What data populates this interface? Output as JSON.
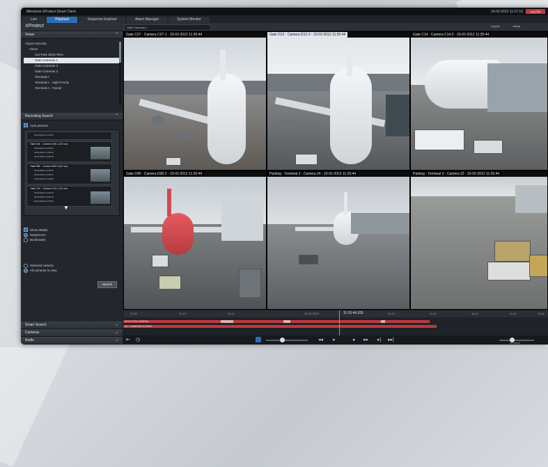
{
  "app": {
    "title": "Milestone XProtect Smart Client",
    "datetime": "23-02-2012 11:27:15",
    "user_badge": "Log Out",
    "brand": "XProtect"
  },
  "tabs": [
    {
      "label": "Live"
    },
    {
      "label": "Playback"
    },
    {
      "label": "Sequence Explorer"
    },
    {
      "label": "Alarm Manager"
    },
    {
      "label": "System Monitor"
    }
  ],
  "active_tab": "Playback",
  "toolbar": {
    "view_select": "Gate Cameras 1",
    "layout_label": "Layout",
    "setup_label": "Setup"
  },
  "views_panel": {
    "title": "Views",
    "tree": [
      {
        "label": "Airport Security",
        "selected": false
      },
      {
        "label": "Views",
        "selected": false
      },
      {
        "label": "Car Park Short Term",
        "selected": false
      },
      {
        "label": "Gate Cameras 1",
        "selected": true
      },
      {
        "label": "Gate Cameras 2",
        "selected": false
      },
      {
        "label": "Gate Cameras 3",
        "selected": false
      },
      {
        "label": "Terminal A",
        "selected": false
      },
      {
        "label": "Terminal A - High Priority",
        "selected": false
      },
      {
        "label": "Terminal A - Transit",
        "selected": false
      }
    ]
  },
  "recording_search": {
    "title": "Recording Search",
    "auto_preview": "Auto preview",
    "results": [
      {
        "title": "",
        "lines": [
          "23-02-2012 11:24:30",
          "",
          ""
        ]
      },
      {
        "title": "Gate D40 - Camera D40-2 (20 sec)",
        "lines": [
          "22-02-2012 11:25:01",
          "22-02-2012 11:25:16",
          "23-02-2012 11:25:35"
        ]
      },
      {
        "title": "Gate D60 - Camera D60-3 (62 sec)",
        "lines": [
          "22-02-2012 11:26:25",
          "23-02-2012 11:26:37",
          "23-02-2012 11:26:43"
        ]
      },
      {
        "title": "Gate C34 - Camera C34-2 (24 sec)",
        "lines": [
          "23-02-2012 11:25:18",
          "23-02-2012 11:25:42",
          "23-02-2012 11:26:30"
        ]
      }
    ],
    "show_details": "Show details",
    "radio_sequences": "Sequences",
    "radio_bookmarks": "Bookmarks",
    "selected_camera": "Selected camera",
    "all_cameras": "All cameras in view",
    "search_button": "Search"
  },
  "bottom_panels": [
    {
      "title": "Smart Search"
    },
    {
      "title": "Cameras"
    },
    {
      "title": "Audio"
    }
  ],
  "cameras": [
    {
      "caption": "Gate C27 - Camera C27-1 - 23-02-2012 11:25:44",
      "selected": false
    },
    {
      "caption": "Gate D12 - Camera D12-3 - 23-02-2012 11:25:44",
      "selected": true
    },
    {
      "caption": "Gate C14 - Camera C14-2 - 23-02-2012 11:25:44",
      "selected": false
    },
    {
      "caption": "Gate D30 - Camera D30-2 - 23-02-2012 11:25:44",
      "selected": false
    },
    {
      "caption": "Parking - Terminal 3 - Camera 24 - 23-02-2012 11:25:44",
      "selected": false
    },
    {
      "caption": "Parking - Terminal 3 - Camera 22 - 23-02-2012 11:25:44",
      "selected": false
    }
  ],
  "timeline": {
    "ticks": [
      "11:09",
      "11:10",
      "11:11",
      "23-02-2012",
      "11:12",
      "11:13",
      "11:14",
      "11:15",
      "11:16"
    ],
    "current_time": "11:25:44.935",
    "track1_label": "SELECTED CAMERA",
    "track2_label": "ALL CAMERAS IN VIEW",
    "speed_label": "1x Speed"
  },
  "colors": {
    "accent": "#2a6fb5",
    "recording": "#c0393d",
    "background": "#1a1d21"
  }
}
